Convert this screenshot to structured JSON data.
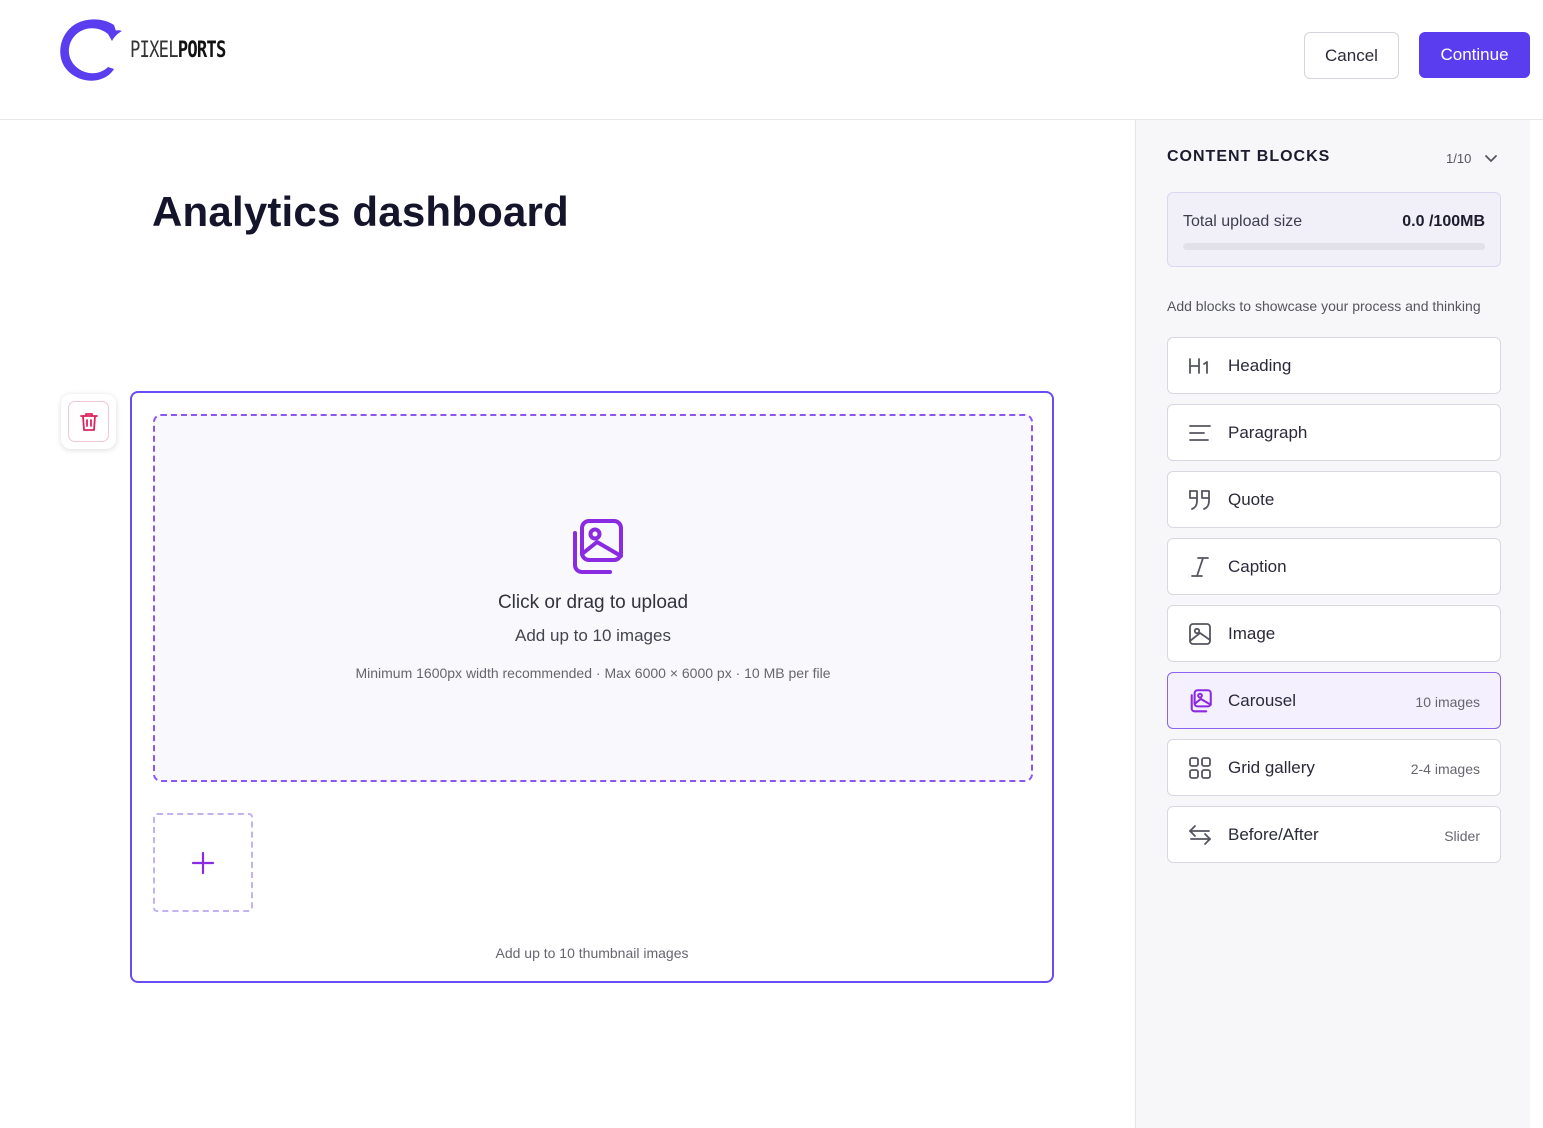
{
  "header": {
    "logo_light": "PIXEL",
    "logo_bold": "PORTS",
    "cancel_label": "Cancel",
    "continue_label": "Continue",
    "accent_color": "#5b3df0"
  },
  "main": {
    "title": "Analytics dashboard",
    "dropzone": {
      "icon": "images-icon",
      "title": "Click or drag to upload",
      "subtitle": "Add up to 10 images",
      "hint": "Minimum 1600px width recommended · Max 6000 × 6000 px · 10 MB per file"
    },
    "thumbnail_hint": "Add up to 10 thumbnail images"
  },
  "sidebar": {
    "title": "CONTENT BLOCKS",
    "count": "1/10",
    "upload": {
      "label": "Total upload size",
      "value": "0.0 /100MB",
      "progress_percent": 0
    },
    "description": "Add blocks to showcase your process and thinking",
    "blocks": [
      {
        "label": "Heading",
        "meta": "",
        "icon": "heading-icon",
        "active": false
      },
      {
        "label": "Paragraph",
        "meta": "",
        "icon": "paragraph-icon",
        "active": false
      },
      {
        "label": "Quote",
        "meta": "",
        "icon": "quote-icon",
        "active": false
      },
      {
        "label": "Caption",
        "meta": "",
        "icon": "caption-icon",
        "active": false
      },
      {
        "label": "Image",
        "meta": "",
        "icon": "image-icon",
        "active": false
      },
      {
        "label": "Carousel",
        "meta": "10 images",
        "icon": "carousel-icon",
        "active": true
      },
      {
        "label": "Grid gallery",
        "meta": "2-4 images",
        "icon": "grid-icon",
        "active": false
      },
      {
        "label": "Before/After",
        "meta": "Slider",
        "icon": "swap-icon",
        "active": false
      }
    ]
  }
}
